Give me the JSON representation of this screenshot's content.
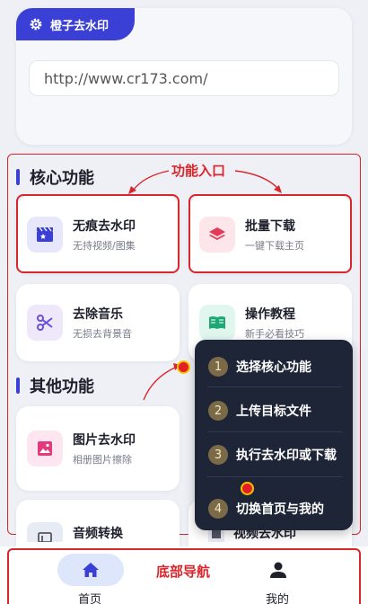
{
  "app": {
    "title": "橙子去水印"
  },
  "url_input": {
    "value": "http://www.cr173.com/"
  },
  "sections": {
    "core": "核心功能",
    "other": "其他功能"
  },
  "core_features": [
    {
      "title": "无痕去水印",
      "subtitle": "无持视频/图集"
    },
    {
      "title": "批量下载",
      "subtitle": "一键下载主页"
    },
    {
      "title": "去除音乐",
      "subtitle": "无损去背景音"
    },
    {
      "title": "操作教程",
      "subtitle": "新手必看技巧"
    }
  ],
  "other_features": [
    {
      "title": "图片去水印",
      "subtitle": "相册图片擦除"
    },
    {
      "title": "音频转换",
      "subtitle": ""
    },
    {
      "title": "视频去水印",
      "subtitle": ""
    }
  ],
  "annotations": {
    "feature_entry": "功能入口",
    "bottom_nav": "底部导航"
  },
  "steps": [
    {
      "num": "1",
      "text": "选择核心功能"
    },
    {
      "num": "2",
      "text": "上传目标文件"
    },
    {
      "num": "3",
      "text": "执行去水印或下载"
    },
    {
      "num": "4",
      "text": "切换首页与我的"
    }
  ],
  "nav": {
    "home": "首页",
    "mine": "我的"
  },
  "colors": {
    "primary": "#3a3fd6",
    "annotation_red": "#d8262b",
    "popup_bg": "#1e2536",
    "step_badge": "#7a6a48"
  }
}
